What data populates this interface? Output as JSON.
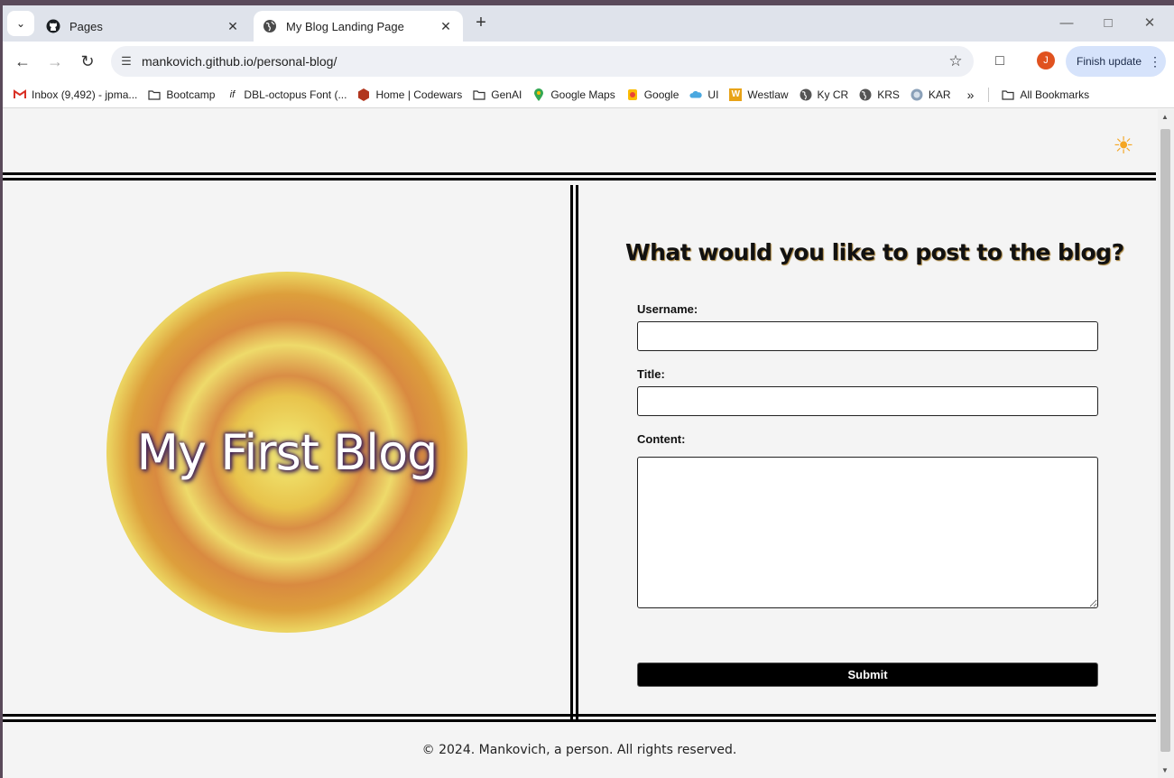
{
  "browser": {
    "tabs": [
      {
        "title": "Pages",
        "icon": "github-icon",
        "active": false
      },
      {
        "title": "My Blog Landing Page",
        "icon": "globe-icon",
        "active": true
      }
    ],
    "url": "mankovich.github.io/personal-blog/",
    "profile_initial": "J",
    "finish_update_label": "Finish update",
    "bookmarks": [
      {
        "label": "Inbox (9,492) - jpma...",
        "icon": "gmail-icon"
      },
      {
        "label": "Bootcamp",
        "icon": "folder-icon"
      },
      {
        "label": "DBL-octopus Font (...",
        "icon": "font-icon"
      },
      {
        "label": "Home | Codewars",
        "icon": "codewars-icon"
      },
      {
        "label": "GenAI",
        "icon": "folder-icon"
      },
      {
        "label": "Google Maps",
        "icon": "maps-pin-icon"
      },
      {
        "label": "Google",
        "icon": "google-icon"
      },
      {
        "label": "UI",
        "icon": "cloud-icon"
      },
      {
        "label": "Westlaw",
        "icon": "westlaw-icon"
      },
      {
        "label": "Ky CR",
        "icon": "globe-icon"
      },
      {
        "label": "KRS",
        "icon": "globe-icon"
      },
      {
        "label": "KAR",
        "icon": "seal-icon"
      }
    ],
    "all_bookmarks_label": "All Bookmarks"
  },
  "page": {
    "theme_toggle_icon": "sun-icon",
    "blog_title": "My First Blog",
    "form": {
      "heading": "What would you like to post to the blog?",
      "username_label": "Username:",
      "username_value": "",
      "title_label": "Title:",
      "title_value": "",
      "content_label": "Content:",
      "content_value": "",
      "submit_label": "Submit"
    },
    "footer": "© 2024. Mankovich, a person. All rights reserved."
  },
  "colors": {
    "accent_sun": "#f5a623",
    "page_bg": "#f4f4f4",
    "submit_bg": "#000000",
    "profile_avatar": "#e0521f"
  }
}
